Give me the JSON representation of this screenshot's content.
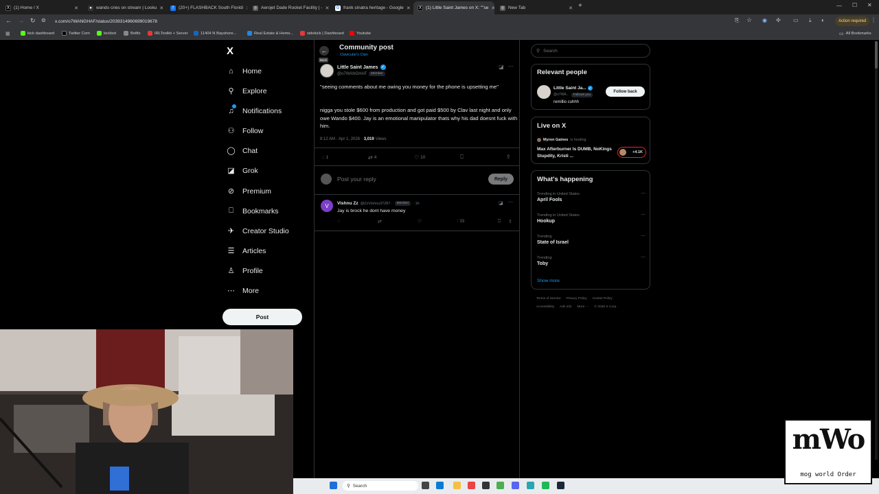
{
  "browser": {
    "tabs": [
      {
        "title": "(1) Home / X",
        "fav": "X",
        "color": "#000"
      },
      {
        "title": "wando cries on stream | Looku",
        "fav": "●",
        "color": "#333"
      },
      {
        "title": "(20+) FLASHBACK South Floridi",
        "fav": "f",
        "color": "#1877f2"
      },
      {
        "title": "Aerojet Dade Rocket Facility | -",
        "fav": "◎",
        "color": "#555"
      },
      {
        "title": "frank sinatra heritage - Google",
        "fav": "G",
        "color": "#4285f4"
      },
      {
        "title": "(1) Little Saint James on X: \"\"se",
        "fav": "X",
        "color": "#000"
      },
      {
        "title": "New Tab",
        "fav": "◎",
        "color": "#555"
      }
    ],
    "url": "x.com/o7WANGHAF/status/2039314960699019678",
    "action_required": "Action required",
    "all_bookmarks": "All Bookmarks",
    "bookmarks": [
      {
        "label": "kick dashboard",
        "color": "#53fc18"
      },
      {
        "label": "Twitter Com",
        "color": "#000"
      },
      {
        "label": "kickbot",
        "color": "#53fc18"
      },
      {
        "label": "Botfix",
        "color": "#888"
      },
      {
        "label": "IRLToolkit + Server",
        "color": "#e53935"
      },
      {
        "label": "11404 N Bayshore...",
        "color": "#1565c0"
      },
      {
        "label": "Real Estate & Home...",
        "color": "#1e88e5"
      },
      {
        "label": "sidekick | Dashboard",
        "color": "#e53935"
      },
      {
        "label": "Youtube",
        "color": "#ff0000"
      }
    ]
  },
  "nav": {
    "logo": "X",
    "items": [
      {
        "label": "Home",
        "icon": "⌂"
      },
      {
        "label": "Explore",
        "icon": "⚲"
      },
      {
        "label": "Notifications",
        "icon": "♫"
      },
      {
        "label": "Follow",
        "icon": "⚇"
      },
      {
        "label": "Chat",
        "icon": "◯"
      },
      {
        "label": "Grok",
        "icon": "◪"
      },
      {
        "label": "Premium",
        "icon": "⊘"
      },
      {
        "label": "Bookmarks",
        "icon": "⎕"
      },
      {
        "label": "Creator Studio",
        "icon": "✈"
      },
      {
        "label": "Articles",
        "icon": "☰"
      },
      {
        "label": "Profile",
        "icon": "♙"
      },
      {
        "label": "More",
        "icon": "⋯"
      }
    ],
    "post_label": "Post"
  },
  "post": {
    "header_title": "Community post",
    "community": "Clavicular's Clan",
    "back_tooltip": "Back",
    "author_name": "Little Saint James",
    "author_handle": "@o7WANGHAF",
    "member_badge": "Member",
    "text_1": "\"seeing comments about me owing you money for the phone is upsetting me\"",
    "text_2": "nigga you stole $600 from production and got paid $500 by Clav last night and only owe Wando $400. Jay is an emotional manipulator thats why his dad doesnt fuck with him.",
    "time": "8:12 AM · Apr 1, 2026 ·",
    "views_count": "3,019",
    "views_label": "Views",
    "replies": "1",
    "reposts": "4",
    "likes": "10",
    "reply_placeholder": "Post your reply",
    "reply_button": "Reply"
  },
  "reply": {
    "avatar_letter": "V",
    "name": "Vishnu Zz",
    "handle": "@ZzVishnu37287 ·",
    "badge": "Member",
    "time": "· 1h",
    "text": "Jay is brock he dont have money",
    "views": "33"
  },
  "right": {
    "search_placeholder": "Search",
    "relevant_title": "Relevant people",
    "rp_name": "Little Saint Ja...",
    "rp_handle": "@o7WA...",
    "rp_follows": "Follows you",
    "rp_bio": "remillio cuhhh",
    "follow_back": "Follow back",
    "live_title": "Live on X",
    "live_host": "Myron Gaines",
    "live_hosting": "is hosting",
    "live_text": "Max Afterburner Is DUMB, NoKings Stupdity, Kristi ...",
    "live_count": "+4.1K",
    "happening_title": "What's happening",
    "trends": [
      {
        "context": "Trending in United States",
        "title": "April Fools"
      },
      {
        "context": "Trending in United States",
        "title": "Hookup"
      },
      {
        "context": "Trending",
        "title": "State of Israel"
      },
      {
        "context": "Trending",
        "title": "Toby"
      }
    ],
    "show_more": "Show more",
    "footer_1": [
      "Terms of Service",
      "Privacy Policy",
      "Cookie Policy"
    ],
    "footer_2": [
      "Accessibility",
      "Ads info",
      "More ···",
      "© 2026 X Corp."
    ]
  },
  "taskbar": {
    "search": "Search"
  },
  "overlay": {
    "logo_text": "mWo",
    "logo_sub": "mog world Order"
  }
}
